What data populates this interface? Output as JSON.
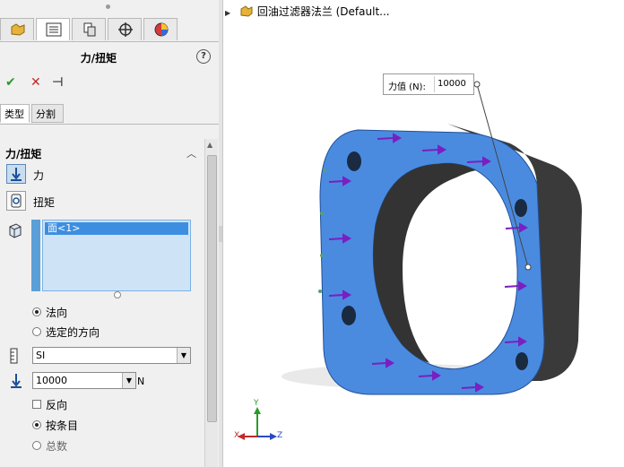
{
  "panel": {
    "tabs": [
      {
        "icon": "feature-manager-icon"
      },
      {
        "icon": "property-manager-icon"
      },
      {
        "icon": "configuration-manager-icon"
      },
      {
        "icon": "dimxpert-icon"
      },
      {
        "icon": "display-manager-icon"
      }
    ],
    "title": "力/扭矩",
    "help": "?",
    "actions": {
      "ok": "✔",
      "cancel": "✕",
      "pin": "⊣"
    },
    "subtabs": [
      "类型",
      "分割"
    ],
    "group_title": "力/扭矩",
    "force_label": "力",
    "torque_label": "扭矩",
    "selection_item": "面<1>",
    "options": {
      "normal": "法向",
      "selected_direction": "选定的方向"
    },
    "unit_value": "SI",
    "force_value": "10000",
    "force_unit": "N",
    "reverse_label": "反向",
    "per_item_label": "按条目",
    "total_label": "总数"
  },
  "viewport": {
    "tree_label": "回油过滤器法兰  (Default...",
    "callout_label": "力值 (N):",
    "callout_value": "10000",
    "triad": {
      "x": "X",
      "y": "Y",
      "z": "Z"
    }
  },
  "colors": {
    "face_blue": "#4a8be0",
    "body_dark": "#3a3a3a",
    "arrow_purple": "#7a1fc2",
    "accent": "#3d8ee0"
  }
}
